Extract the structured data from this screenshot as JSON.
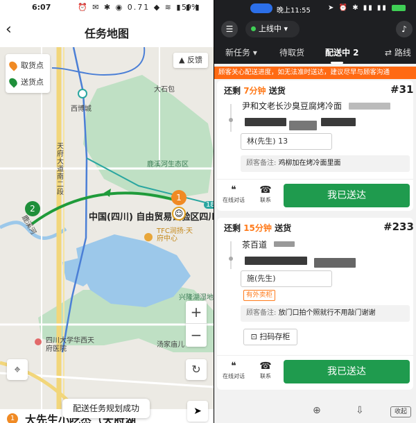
{
  "left": {
    "status": {
      "time": "6:07",
      "icons": "⏰ ✉ ✱ ◉ 0.71 ◆ ≋ ▮ ▮ ▮",
      "battery": "59%"
    },
    "title": "任务地图",
    "legend": {
      "pickup": "取货点",
      "delivery": "送货点"
    },
    "feedback": "反馈",
    "map_labels": {
      "xibocheng": "西博城",
      "dashibao": "大石包",
      "tianfu_road": "天府大道南二段",
      "luxihe_park": "鹿溪河生态区",
      "luxihe": "鹿溪河",
      "ftz": "中国(四川) 自由贸易试验区四川",
      "tfc": "TFC润扬·天府中心",
      "xinglong_lake": "兴隆湖湿地",
      "hospital": "四川大学华西天府医院",
      "tangjiamiao": "汤家庙儿",
      "metro_18": "18"
    },
    "markers": {
      "pickup_num": "1",
      "delivery_num": "2"
    },
    "zoom_in": "+",
    "zoom_out": "−",
    "toast": "配送任务规划成功",
    "bottom": {
      "num": "1",
      "name": "大先生小吃杰（天府湖"
    },
    "colors": {
      "pickup": "#f08a24",
      "delivery": "#1f8f3a",
      "route": "#1f9b3a"
    }
  },
  "right": {
    "status": {
      "time": "晚上11:55"
    },
    "online": "上线中",
    "tabs": [
      "新任务",
      "待取货",
      "配送中 2",
      "路线"
    ],
    "notice": "顾客关心配送进度，如无法准时送达，建议尽早与顾客沟通",
    "orders": [
      {
        "remain_prefix": "还剩",
        "remain_minutes": "7分钟",
        "remain_suffix": "送货",
        "order_no": "#31",
        "shop": "尹和文老长沙臭豆腐烤冷面",
        "customer": "林(先生) 13",
        "note_label": "顾客备注:",
        "note_text": "鸡柳加在烤冷面里面",
        "chat": "在线对话",
        "call": "联系",
        "done": "我已送达"
      },
      {
        "remain_prefix": "还剩",
        "remain_minutes": "15分钟",
        "remain_suffix": "送货",
        "order_no": "#233",
        "shop": "茶百道",
        "customer": "施(先生)",
        "tag": "有外卖柜",
        "note_label": "顾客备注:",
        "note_text": "放门口拍个照就行不用敲门谢谢",
        "scan": "扫码存柜",
        "chat": "在线对话",
        "call": "联系",
        "done": "我已送达"
      }
    ],
    "bottom": {
      "collapse": "收起"
    },
    "colors": {
      "accent": "#ff7a1a",
      "done": "#1f9b4e",
      "header": "#1e1f22"
    }
  }
}
